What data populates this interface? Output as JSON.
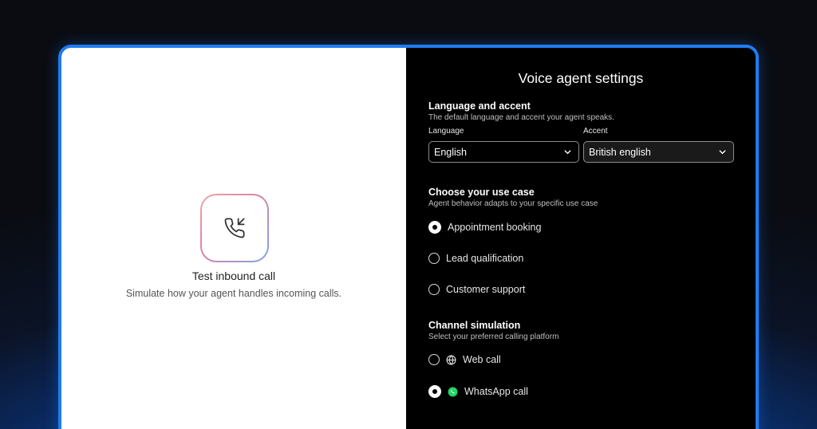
{
  "test_panel": {
    "title": "Test inbound call",
    "subtitle": "Simulate how your agent handles incoming calls.",
    "icon": "phone-incoming-icon"
  },
  "settings": {
    "title": "Voice agent settings",
    "language_section": {
      "heading": "Language and accent",
      "description": "The default language and accent your agent speaks.",
      "language_label": "Language",
      "language_value": "English",
      "accent_label": "Accent",
      "accent_value": "British english"
    },
    "use_case_section": {
      "heading": "Choose your use case",
      "description": "Agent behavior adapts to your specific use case",
      "options": [
        {
          "label": "Appointment booking",
          "selected": true
        },
        {
          "label": "Lead qualification",
          "selected": false
        },
        {
          "label": "Customer support",
          "selected": false
        }
      ]
    },
    "channel_section": {
      "heading": "Channel simulation",
      "description": "Select your preferred calling platform",
      "options": [
        {
          "label": "Web call",
          "icon": "globe-icon",
          "selected": false
        },
        {
          "label": "WhatsApp call",
          "icon": "whatsapp-icon",
          "selected": true
        }
      ]
    }
  },
  "colors": {
    "frame_border": "#1f7cf0",
    "whatsapp_green": "#25d366"
  }
}
